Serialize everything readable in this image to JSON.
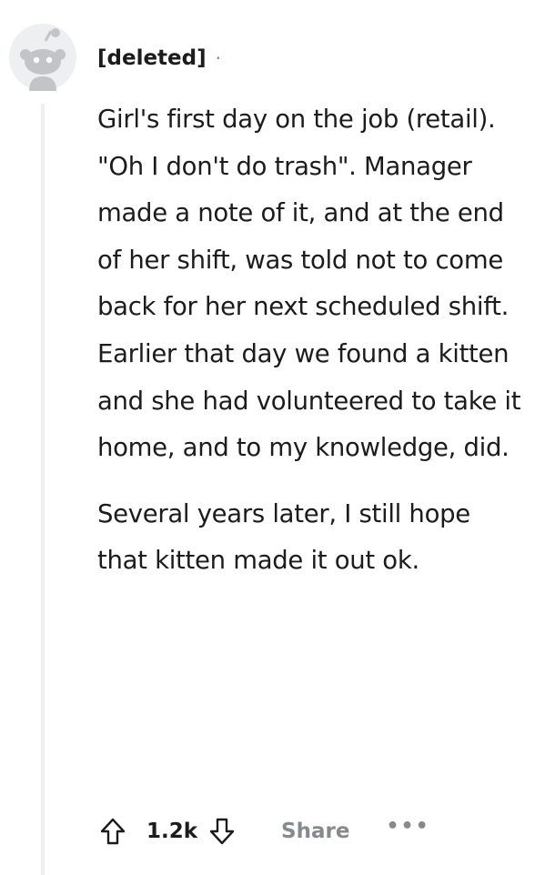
{
  "comment": {
    "author": "[deleted]",
    "separator": "·",
    "paragraphs": [
      "Girl's first day on the job (retail). \"Oh I don't do trash\". Manager made a note of it, and at the end of her shift, was told not to come back for her next scheduled shift. Earlier that day we found a kitten and she had volunteered to take it home, and to my knowledge, did.",
      "Several years later, I still hope that kitten made it out ok."
    ],
    "actions": {
      "upvote_icon": "upvote-arrow-icon",
      "vote_count": "1.2k",
      "downvote_icon": "downvote-arrow-icon",
      "share_label": "Share",
      "more_label": "•••"
    }
  },
  "colors": {
    "text": "#1c1c1c",
    "muted": "#878a8c",
    "thread_line": "#edeff1",
    "avatar": "#d7dadc"
  }
}
